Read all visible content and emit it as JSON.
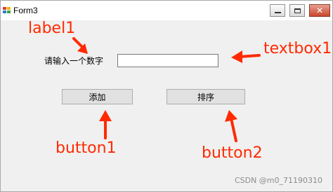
{
  "window": {
    "title": "Form3",
    "close_glyph": "✕"
  },
  "form": {
    "label1_text": "请输入一个数字",
    "textbox1_value": "",
    "button1_label": "添加",
    "button2_label": "排序"
  },
  "annotations": {
    "label1": "label1",
    "textbox1": "textbox1",
    "button1": "button1",
    "button2": "button2",
    "color": "#ff2a00"
  },
  "watermark": "CSDN @m0_71190310",
  "icons": [
    "app-icon",
    "minimize-icon",
    "maximize-icon",
    "close-icon",
    "arrow-icon"
  ]
}
